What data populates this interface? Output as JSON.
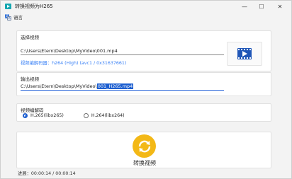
{
  "window": {
    "title": "转换视频为H265",
    "minimize_glyph": "—",
    "maximize_glyph": "☐",
    "close_glyph": "✕"
  },
  "menu": {
    "language_label": "语言",
    "language_icon": "translate-icon",
    "icon_glyph_a": "文",
    "icon_glyph_b": "A"
  },
  "input_group": {
    "label": "选择视频",
    "path": "C:\\Users\\Etern\\Desktop\\MyVideo\\001.mp4",
    "codec_info": "视频编解码器：h264 (High) (avc1 / 0x31637661)",
    "thumbnail_icon": "video-file-icon"
  },
  "output_group": {
    "label": "输出视频",
    "path_prefix": "C:\\Users\\Etern\\Desktop\\MyVideo\\",
    "path_selected": "001_H265.mp4"
  },
  "encoder_group": {
    "label": "视频编解码",
    "options": [
      {
        "label": "H.265(libx265)",
        "selected": true
      },
      {
        "label": "H.264(libx264)",
        "selected": false
      }
    ]
  },
  "convert": {
    "label": "转换视频",
    "icon": "convert-refresh-icon",
    "accent": "#f3b816"
  },
  "progress": {
    "text": "进展：00:00:14 / 00:00:14"
  },
  "colors": {
    "link": "#3b82f6",
    "selection": "#1d5fd0",
    "app_icon": "#15a7b1"
  }
}
